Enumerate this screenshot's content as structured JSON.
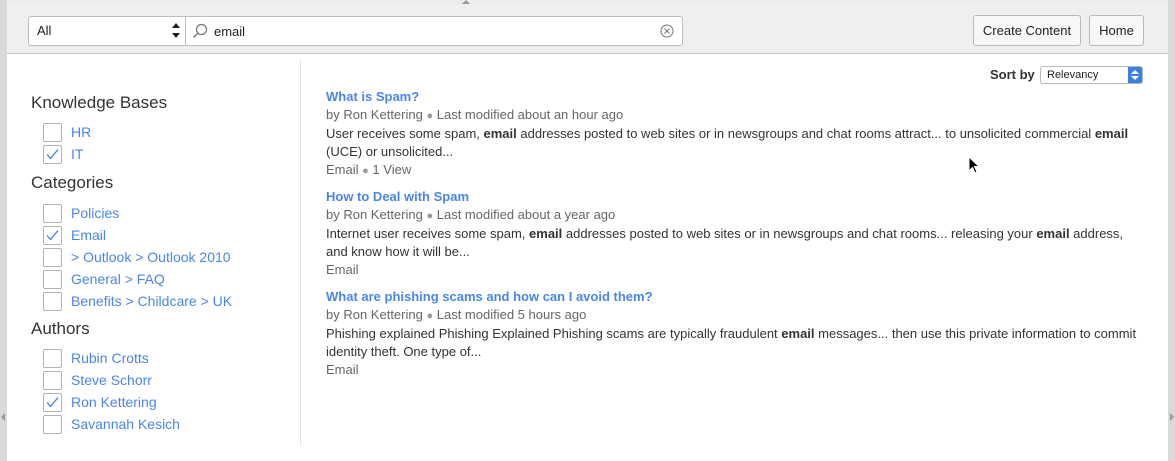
{
  "toolbar": {
    "scope_value": "All",
    "search_value": "email",
    "create_label": "Create Content",
    "home_label": "Home"
  },
  "sort": {
    "label": "Sort by",
    "value": "Relevancy"
  },
  "facets": {
    "knowledge_bases": {
      "title": "Knowledge Bases",
      "items": [
        {
          "label": "HR",
          "checked": false
        },
        {
          "label": "IT",
          "checked": true
        }
      ]
    },
    "categories": {
      "title": "Categories",
      "items": [
        {
          "label": "Policies",
          "checked": false
        },
        {
          "label": "Email",
          "checked": true
        },
        {
          "label": "> Outlook > Outlook 2010",
          "checked": false
        },
        {
          "label": "General > FAQ",
          "checked": false
        },
        {
          "label": "Benefits > Childcare > UK",
          "checked": false
        }
      ]
    },
    "authors": {
      "title": "Authors",
      "items": [
        {
          "label": "Rubin Crotts",
          "checked": false
        },
        {
          "label": "Steve Schorr",
          "checked": false
        },
        {
          "label": "Ron Kettering",
          "checked": true
        },
        {
          "label": "Savannah Kesich",
          "checked": false
        }
      ]
    }
  },
  "results": [
    {
      "title": "What is Spam?",
      "author": "by Ron Kettering",
      "modified": "Last modified about an hour ago",
      "snippet": [
        {
          "text": "User receives some spam, ",
          "bold": false
        },
        {
          "text": "email",
          "bold": true
        },
        {
          "text": " addresses posted to web sites or in newsgroups and chat rooms attract... to unsolicited commercial ",
          "bold": false
        },
        {
          "text": "email",
          "bold": true
        },
        {
          "text": " (UCE) or unsolicited...",
          "bold": false
        }
      ],
      "tag": "Email",
      "views": "1 View"
    },
    {
      "title": "How to Deal with Spam",
      "author": "by Ron Kettering",
      "modified": "Last modified about a year ago",
      "snippet": [
        {
          "text": "Internet user receives some spam, ",
          "bold": false
        },
        {
          "text": "email",
          "bold": true
        },
        {
          "text": " addresses posted to web sites or in newsgroups and chat rooms... releasing your ",
          "bold": false
        },
        {
          "text": "email",
          "bold": true
        },
        {
          "text": " address, and know how it will be...",
          "bold": false
        }
      ],
      "tag": "Email",
      "views": ""
    },
    {
      "title": "What are phishing scams and how can I avoid them?",
      "author": "by Ron Kettering",
      "modified": "Last modified 5 hours ago",
      "snippet": [
        {
          "text": "Phishing explained Phishing Explained Phishing scams are typically fraudulent ",
          "bold": false
        },
        {
          "text": "email",
          "bold": true
        },
        {
          "text": " messages... then use this private information to commit identity theft. One type of...",
          "bold": false
        }
      ],
      "tag": "Email",
      "views": ""
    }
  ]
}
